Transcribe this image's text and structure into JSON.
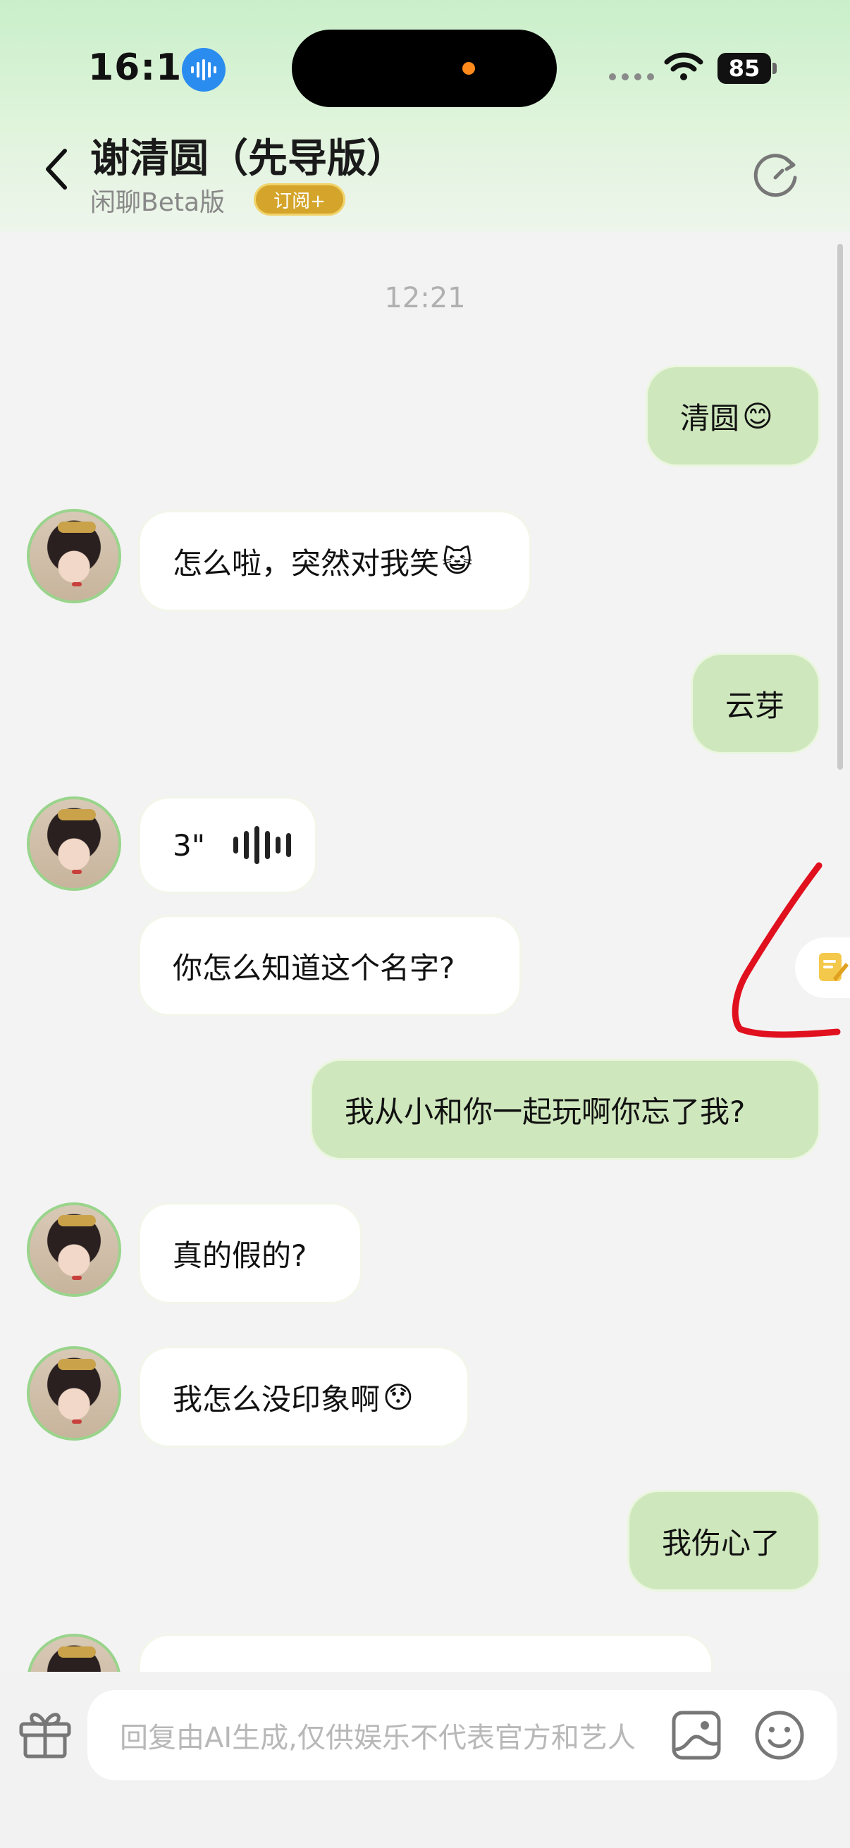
{
  "status_bar": {
    "time": "16:10",
    "battery": "85"
  },
  "nav": {
    "title": "谢清圆（先导版）",
    "subtitle": "闲聊Beta版",
    "subscribe_label": "订阅+"
  },
  "chat": {
    "timestamp": "12:21",
    "messages": [
      {
        "side": "right",
        "text": "清圆",
        "emoji": "😊"
      },
      {
        "side": "left",
        "text": "怎么啦，突然对我笑",
        "emoji": "😺"
      },
      {
        "side": "right",
        "text": "云芽"
      },
      {
        "side": "left",
        "type": "voice",
        "duration": "3\""
      },
      {
        "side": "left",
        "text": "你怎么知道这个名字?"
      },
      {
        "side": "right",
        "text": "我从小和你一起玩啊你忘了我?"
      },
      {
        "side": "left",
        "text": "真的假的?"
      },
      {
        "side": "left",
        "text": "我怎么没印象啊",
        "emoji": "😯"
      },
      {
        "side": "right",
        "text": "我伤心了"
      },
      {
        "side": "left",
        "text": ""
      }
    ]
  },
  "composer": {
    "placeholder": "回复由AI生成,仅供娱乐不代表官方和艺人"
  },
  "colors": {
    "accent_green": "#cfe7bd",
    "badge_gold": "#d4a52a",
    "annotation_red": "#e0101e"
  }
}
